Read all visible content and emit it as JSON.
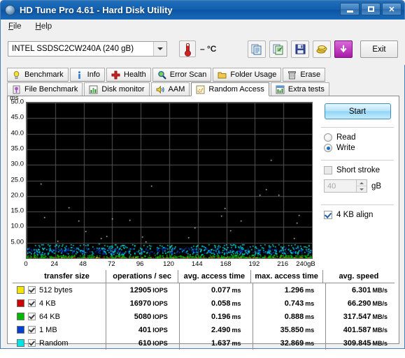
{
  "window": {
    "title": "HD Tune Pro 4.61 - Hard Disk Utility",
    "icon": "disk-icon",
    "minimize": "minimize-icon",
    "maximize": "maximize-icon",
    "close": "close-icon"
  },
  "menu": {
    "items": [
      {
        "label": "File",
        "accel": "F"
      },
      {
        "label": "Help",
        "accel": "H"
      }
    ]
  },
  "toolbar": {
    "drive": "INTEL SSDSC2CW240A (240 gB)",
    "temperature": "– °C",
    "thermo_icon": "thermometer-icon",
    "buttons": [
      {
        "name": "copy-icon"
      },
      {
        "name": "copy-excel-icon"
      },
      {
        "name": "save-icon"
      },
      {
        "name": "coins-icon"
      },
      {
        "name": "download-icon"
      }
    ],
    "exit_label": "Exit"
  },
  "tabs": {
    "row1": [
      {
        "label": "Benchmark",
        "icon": "lightbulb-icon",
        "active": false
      },
      {
        "label": "Info",
        "icon": "info-icon",
        "active": false
      },
      {
        "label": "Health",
        "icon": "health-cross-icon",
        "active": false
      },
      {
        "label": "Error Scan",
        "icon": "magnifier-icon",
        "active": false
      },
      {
        "label": "Folder Usage",
        "icon": "folder-icon",
        "active": false
      },
      {
        "label": "Erase",
        "icon": "trash-icon",
        "active": false
      }
    ],
    "row2": [
      {
        "label": "File Benchmark",
        "icon": "file-benchmark-icon",
        "active": false
      },
      {
        "label": "Disk monitor",
        "icon": "bar-chart-icon",
        "active": false
      },
      {
        "label": "AAM",
        "icon": "speaker-icon",
        "active": false
      },
      {
        "label": "Random Access",
        "icon": "scatter-icon",
        "active": true
      },
      {
        "label": "Extra tests",
        "icon": "grid-chart-icon",
        "active": false
      }
    ]
  },
  "controls": {
    "start_label": "Start",
    "read_label": "Read",
    "write_label": "Write",
    "mode_selected": "Write",
    "short_stroke_label": "Short stroke",
    "short_stroke_checked": false,
    "short_stroke_value": "40",
    "short_stroke_unit": "gB",
    "align_label": "4 KB align",
    "align_checked": true
  },
  "chart_data": {
    "type": "scatter",
    "title": "",
    "xlabel": "240gB",
    "ylabel": "ms",
    "xlim": [
      0,
      240
    ],
    "ylim": [
      0,
      50
    ],
    "ytick_unit": "ms",
    "xticks": [
      0,
      24,
      48,
      72,
      96,
      120,
      144,
      168,
      192,
      216,
      240
    ],
    "xtick_labels": [
      "0",
      "24",
      "48",
      "72",
      "96",
      "120",
      "144",
      "168",
      "192",
      "216",
      "240gB"
    ],
    "yticks": [
      5.0,
      10.0,
      15.0,
      20.0,
      25.0,
      30.0,
      35.0,
      40.0,
      45.0,
      50.0
    ],
    "ytick_labels": [
      "5.00",
      "10.0",
      "15.0",
      "20.0",
      "25.0",
      "30.0",
      "35.0",
      "40.0",
      "45.0",
      "50.0"
    ],
    "grid": true,
    "plot_background": "#000000",
    "grid_color": "#555555",
    "series": [
      {
        "name": "512 bytes",
        "color": "#f2e600",
        "band_low": 0.05,
        "band_high": 0.35,
        "density": 170
      },
      {
        "name": "4 KB",
        "color": "#cc0000",
        "band_low": 0.05,
        "band_high": 0.4,
        "density": 170
      },
      {
        "name": "64 KB",
        "color": "#00b800",
        "band_low": 0.1,
        "band_high": 1.1,
        "density": 420
      },
      {
        "name": "1 MB",
        "color": "#0040d0",
        "band_low": 1.6,
        "band_high": 3.4,
        "density": 300
      },
      {
        "name": "Random",
        "color": "#00e4e4",
        "band_low": 1.2,
        "band_high": 4.6,
        "density": 420
      }
    ],
    "outlier_color": "#ffffff",
    "outliers": 26
  },
  "table": {
    "headers": [
      "transfer size",
      "operations / sec",
      "avg. access time",
      "max. access time",
      "avg. speed"
    ],
    "rows": [
      {
        "color": "#f2e600",
        "checked": true,
        "size": "512 bytes",
        "iops": "12905",
        "iops_unit": "IOPS",
        "avg_access": "0.077",
        "avg_access_unit": "ms",
        "max_access": "1.296",
        "max_access_unit": "ms",
        "speed": "6.301",
        "speed_unit": "MB/s"
      },
      {
        "color": "#cc0000",
        "checked": true,
        "size": "4 KB",
        "iops": "16970",
        "iops_unit": "IOPS",
        "avg_access": "0.058",
        "avg_access_unit": "ms",
        "max_access": "0.743",
        "max_access_unit": "ms",
        "speed": "66.290",
        "speed_unit": "MB/s"
      },
      {
        "color": "#00b800",
        "checked": true,
        "size": "64 KB",
        "iops": "5080",
        "iops_unit": "IOPS",
        "avg_access": "0.196",
        "avg_access_unit": "ms",
        "max_access": "0.888",
        "max_access_unit": "ms",
        "speed": "317.547",
        "speed_unit": "MB/s"
      },
      {
        "color": "#0040d0",
        "checked": true,
        "size": "1 MB",
        "iops": "401",
        "iops_unit": "IOPS",
        "avg_access": "2.490",
        "avg_access_unit": "ms",
        "max_access": "35.850",
        "max_access_unit": "ms",
        "speed": "401.587",
        "speed_unit": "MB/s"
      },
      {
        "color": "#00e4e4",
        "checked": true,
        "size": "Random",
        "iops": "610",
        "iops_unit": "IOPS",
        "avg_access": "1.637",
        "avg_access_unit": "ms",
        "max_access": "32.869",
        "max_access_unit": "ms",
        "speed": "309.845",
        "speed_unit": "MB/s"
      }
    ]
  }
}
